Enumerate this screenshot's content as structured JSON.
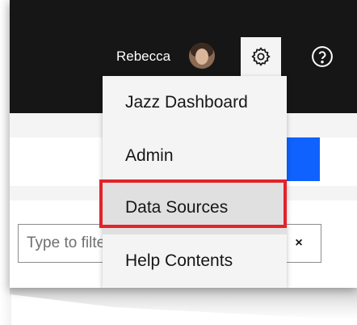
{
  "header": {
    "user_name": "Rebecca"
  },
  "settings_menu": {
    "items": [
      {
        "label": "Jazz Dashboard"
      },
      {
        "label": "Admin"
      },
      {
        "label": "Data Sources"
      },
      {
        "label": "Help Contents"
      }
    ],
    "highlighted_item": "Data Sources",
    "highlight_color": "#e3222a"
  },
  "filter": {
    "placeholder": "Type to filter",
    "clear_label": "×"
  },
  "colors": {
    "topbar": "#161616",
    "primary_button": "#0f62fe",
    "menu_background": "#f4f4f4"
  },
  "icons": {
    "settings": "gear-icon",
    "help": "help-icon",
    "clear": "close-icon"
  }
}
